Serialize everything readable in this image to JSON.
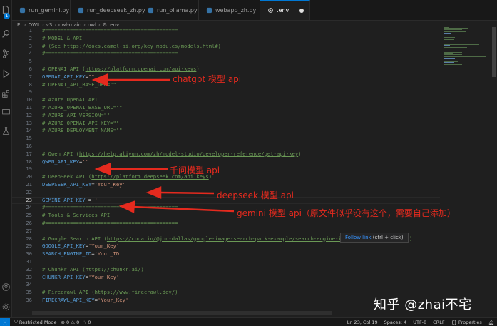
{
  "tabs": [
    {
      "label": "run_gemini.py",
      "active": false
    },
    {
      "label": "run_deepseek_zh.py",
      "active": false
    },
    {
      "label": "run_ollama.py",
      "active": false
    },
    {
      "label": "webapp_zh.py",
      "active": false
    },
    {
      "label": ".env",
      "active": true
    }
  ],
  "breadcrumb": [
    "E:",
    "OWL",
    "v3",
    "owl-main",
    "owl",
    ".env"
  ],
  "activity_badge": "1",
  "lines": [
    {
      "n": "1",
      "t": [
        [
          "c-comment",
          "#==========================================="
        ]
      ]
    },
    {
      "n": "2",
      "t": [
        [
          "c-comment",
          "# MODEL & API"
        ]
      ]
    },
    {
      "n": "3",
      "t": [
        [
          "c-comment",
          "# (See "
        ],
        [
          "c-link",
          "https://docs.camel-ai.org/key_modules/models.html#"
        ],
        [
          "c-comment",
          ")"
        ]
      ]
    },
    {
      "n": "4",
      "t": [
        [
          "c-comment",
          "#==========================================="
        ]
      ]
    },
    {
      "n": "5",
      "t": []
    },
    {
      "n": "6",
      "t": [
        [
          "c-comment",
          "# OPENAI API ("
        ],
        [
          "c-link",
          "https://platform.openai.com/api-keys"
        ],
        [
          "c-comment",
          ")"
        ]
      ]
    },
    {
      "n": "7",
      "t": [
        [
          "c-key",
          "OPENAI_API_KEY"
        ],
        [
          "c-eq",
          "="
        ],
        [
          "c-str",
          "\"\""
        ]
      ]
    },
    {
      "n": "8",
      "t": [
        [
          "c-comment",
          "# OPENAI_API_BASE_URL=\"\""
        ]
      ]
    },
    {
      "n": "9",
      "t": []
    },
    {
      "n": "10",
      "t": [
        [
          "c-comment",
          "# Azure OpenAI API"
        ]
      ]
    },
    {
      "n": "11",
      "t": [
        [
          "c-comment",
          "# AZURE_OPENAI_BASE_URL=\"\""
        ]
      ]
    },
    {
      "n": "12",
      "t": [
        [
          "c-comment",
          "# AZURE_API_VERSION=\"\""
        ]
      ]
    },
    {
      "n": "13",
      "t": [
        [
          "c-comment",
          "# AZURE_OPENAI_API_KEY=\"\""
        ]
      ]
    },
    {
      "n": "14",
      "t": [
        [
          "c-comment",
          "# AZURE_DEPLOYMENT_NAME=\"\""
        ]
      ]
    },
    {
      "n": "15",
      "t": []
    },
    {
      "n": "16",
      "t": []
    },
    {
      "n": "17",
      "t": [
        [
          "c-comment",
          "# Qwen API ("
        ],
        [
          "c-link",
          "https://help.aliyun.com/zh/model-studio/developer-reference/get-api-key"
        ],
        [
          "c-comment",
          ")"
        ]
      ]
    },
    {
      "n": "18",
      "t": [
        [
          "c-key",
          "QWEN_API_KEY"
        ],
        [
          "c-eq",
          "="
        ],
        [
          "c-str",
          "''"
        ]
      ]
    },
    {
      "n": "19",
      "t": []
    },
    {
      "n": "20",
      "t": [
        [
          "c-comment",
          "# DeepSeek API ("
        ],
        [
          "c-link",
          "https://platform.deepseek.com/api_keys"
        ],
        [
          "c-comment",
          ")"
        ]
      ]
    },
    {
      "n": "21",
      "t": [
        [
          "c-key",
          "DEEPSEEK_API_KEY"
        ],
        [
          "c-eq",
          "="
        ],
        [
          "c-str",
          "'Your_Key'"
        ]
      ]
    },
    {
      "n": "22",
      "t": []
    },
    {
      "n": "23",
      "t": [
        [
          "c-key",
          "GEMINI_API_KEY"
        ],
        [
          "c-eq",
          " = "
        ],
        [
          "c-str",
          "'"
        ]
      ]
    },
    {
      "n": "24",
      "t": [
        [
          "c-comment",
          "#==========================================="
        ]
      ]
    },
    {
      "n": "25",
      "t": [
        [
          "c-comment",
          "# Tools & Services API"
        ]
      ]
    },
    {
      "n": "26",
      "t": [
        [
          "c-comment",
          "#==========================================="
        ]
      ]
    },
    {
      "n": "27",
      "t": []
    },
    {
      "n": "28",
      "t": [
        [
          "c-comment",
          "# Google Search API ("
        ],
        [
          "c-link",
          "https://coda.io/@jon-dallas/google-image-search-pack-example/search-engine-id-and-google-api-key-3"
        ],
        [
          "c-comment",
          ")"
        ]
      ]
    },
    {
      "n": "29",
      "t": [
        [
          "c-key",
          "GOOGLE_API_KEY"
        ],
        [
          "c-eq",
          "="
        ],
        [
          "c-str",
          "'Your_Key'"
        ]
      ]
    },
    {
      "n": "30",
      "t": [
        [
          "c-key",
          "SEARCH_ENGINE_ID"
        ],
        [
          "c-eq",
          "="
        ],
        [
          "c-str",
          "'Your_ID'"
        ]
      ]
    },
    {
      "n": "31",
      "t": []
    },
    {
      "n": "32",
      "t": [
        [
          "c-comment",
          "# Chunkr API ("
        ],
        [
          "c-link",
          "https://chunkr.ai/"
        ],
        [
          "c-comment",
          ")"
        ]
      ]
    },
    {
      "n": "33",
      "t": [
        [
          "c-key",
          "CHUNKR_API_KEY"
        ],
        [
          "c-eq",
          "="
        ],
        [
          "c-str",
          "'Your_Key'"
        ]
      ]
    },
    {
      "n": "34",
      "t": []
    },
    {
      "n": "35",
      "t": [
        [
          "c-comment",
          "# Firecrawl API ("
        ],
        [
          "c-link",
          "https://www.firecrawl.dev/"
        ],
        [
          "c-comment",
          ")"
        ]
      ]
    },
    {
      "n": "36",
      "t": [
        [
          "c-key",
          "FIRECRAWL_API_KEY"
        ],
        [
          "c-eq",
          "="
        ],
        [
          "c-str",
          "'Your_Key'"
        ]
      ]
    }
  ],
  "current_line": "23",
  "annotations": {
    "openai": "chatgpt 模型 api",
    "qwen": "千问模型 api",
    "deepseek": "deepseek 模型 api",
    "gemini": "gemini 模型 api（原文件似乎没有这个，需要自己添加）"
  },
  "tooltip": {
    "link": "Follow link",
    "hint": " (ctrl + click)"
  },
  "watermark": "知乎 @zhai不宅",
  "statusbar": {
    "remote": "⟩⟨",
    "mode": "Restricted Mode",
    "problems": "⊗ 0 ⚠ 0",
    "ports": "⑂ 0",
    "position": "Ln 23, Col 19",
    "spaces": "Spaces: 4",
    "encoding": "UTF-8",
    "eol": "CRLF",
    "properties": "Properties"
  },
  "colors": {
    "accent": "#0078d4",
    "annotation": "#e52a1e"
  }
}
